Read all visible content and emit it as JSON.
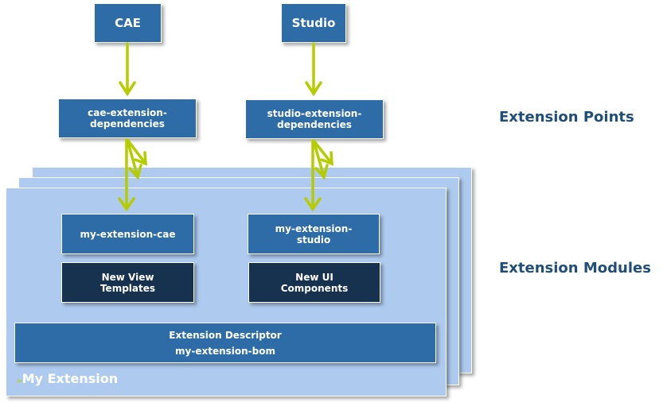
{
  "top": {
    "cae": "CAE",
    "studio": "Studio"
  },
  "points": {
    "cae": [
      "cae-extension-",
      "dependencies"
    ],
    "studio": [
      "studio-extension-",
      "dependencies"
    ]
  },
  "modules": {
    "cae": "my-extension-cae",
    "studio": [
      "my-extension-",
      "studio"
    ],
    "view": [
      "New View",
      "Templates"
    ],
    "ui": [
      "New UI",
      "Components"
    ]
  },
  "descriptor": {
    "line1": "Extension Descriptor",
    "line2": "my-extension-bom"
  },
  "extension_label": "My Extension",
  "headings": {
    "points": "Extension Points",
    "modules": "Extension Modules"
  },
  "colors": {
    "box": "#2e6ca8",
    "dark_box": "#16324f",
    "stack": "#aecbef",
    "arrow": "#b5cc00",
    "heading": "#1f4e79"
  }
}
